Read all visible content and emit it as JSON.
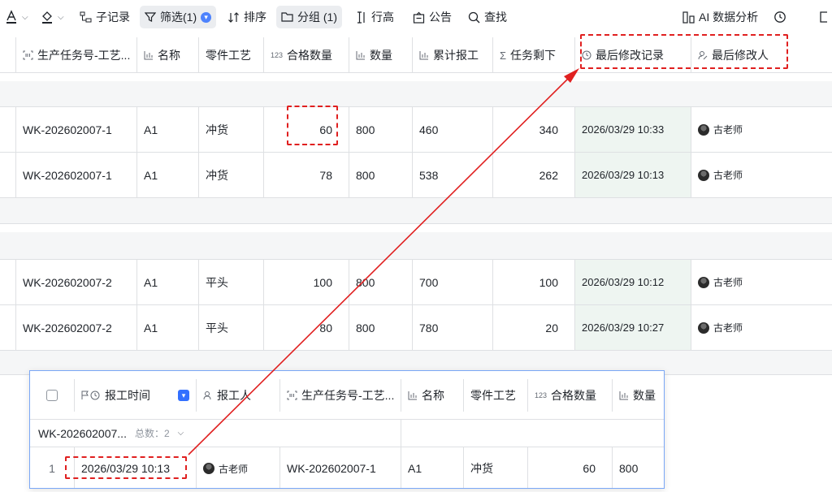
{
  "toolbar": {
    "fill_label": "",
    "subrecord": "子记录",
    "filter": "筛选(1)",
    "filter_count": "",
    "sort": "排序",
    "group": "分组 (1)",
    "row_height": "行高",
    "announcement": "公告",
    "search": "查找",
    "ai_analysis": "AI 数据分析"
  },
  "columns": [
    {
      "label": "生产任务号-工艺...",
      "icon": "barcode-icon"
    },
    {
      "label": "名称",
      "icon": "chart-icon"
    },
    {
      "label": "零件工艺",
      "icon": ""
    },
    {
      "label": "合格数量",
      "icon": "123"
    },
    {
      "label": "数量",
      "icon": "chart-icon"
    },
    {
      "label": "累计报工",
      "icon": "chart-icon"
    },
    {
      "label": "任务剩下",
      "icon": "sigma-icon"
    },
    {
      "label": "最后修改记录",
      "icon": "clock-icon"
    },
    {
      "label": "最后修改人",
      "icon": "user-edit-icon"
    }
  ],
  "rows": [
    {
      "task": "WK-202602007-1",
      "name": "A1",
      "process": "冲货",
      "qualified": "60",
      "qty": "800",
      "cumulative": "460",
      "remaining": "340",
      "modified": "2026/03/29 10:33",
      "modifier": "古老师"
    },
    {
      "task": "WK-202602007-1",
      "name": "A1",
      "process": "冲货",
      "qualified": "78",
      "qty": "800",
      "cumulative": "538",
      "remaining": "262",
      "modified": "2026/03/29 10:13",
      "modifier": "古老师"
    },
    {
      "task": "WK-202602007-2",
      "name": "A1",
      "process": "平头",
      "qualified": "100",
      "qty": "800",
      "cumulative": "700",
      "remaining": "100",
      "modified": "2026/03/29 10:12",
      "modifier": "古老师"
    },
    {
      "task": "WK-202602007-2",
      "name": "A1",
      "process": "平头",
      "qualified": "80",
      "qty": "800",
      "cumulative": "780",
      "remaining": "20",
      "modified": "2026/03/29 10:27",
      "modifier": "古老师"
    }
  ],
  "popup": {
    "columns": [
      {
        "label": "报工时间",
        "icon": "flag-clock-icon"
      },
      {
        "label": "报工人",
        "icon": "user-icon"
      },
      {
        "label": "生产任务号-工艺...",
        "icon": "barcode-icon"
      },
      {
        "label": "名称",
        "icon": "chart-icon"
      },
      {
        "label": "零件工艺",
        "icon": ""
      },
      {
        "label": "合格数量",
        "icon": "123"
      },
      {
        "label": "数量",
        "icon": "chart-icon"
      }
    ],
    "group_title": "WK-202602007...",
    "group_count": "总数：2",
    "row": {
      "index": "1",
      "time": "2026/03/29 10:13",
      "reporter": "古老师",
      "task": "WK-202602007-1",
      "name": "A1",
      "process": "冲货",
      "qualified": "60",
      "qty": "800"
    }
  },
  "colors": {
    "accent": "#3370ff",
    "annotation": "#e02020",
    "highlight_column": "#eef5f1"
  }
}
